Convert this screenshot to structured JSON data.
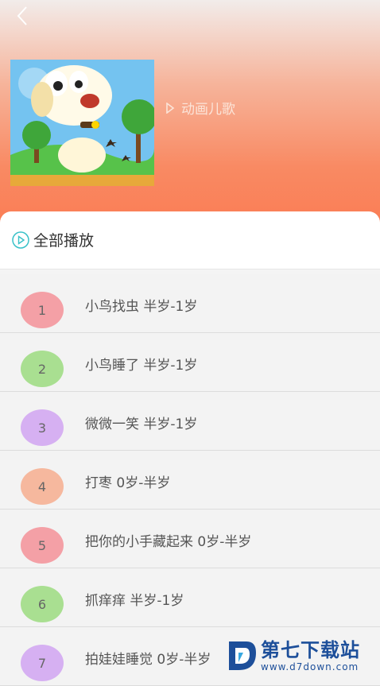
{
  "header": {
    "album_title": "动画儿歌"
  },
  "panel": {
    "play_all_label": "全部播放"
  },
  "songs": [
    {
      "num": "1",
      "title": "小鸟找虫 半岁-1岁",
      "color": "#f4a0a6"
    },
    {
      "num": "2",
      "title": "小鸟睡了 半岁-1岁",
      "color": "#a9df91"
    },
    {
      "num": "3",
      "title": "微微一笑 半岁-1岁",
      "color": "#d6b0f2"
    },
    {
      "num": "4",
      "title": "打枣 0岁-半岁",
      "color": "#f6b89e"
    },
    {
      "num": "5",
      "title": "把你的小手藏起来 0岁-半岁",
      "color": "#f4a0a6"
    },
    {
      "num": "6",
      "title": "抓痒痒 半岁-1岁",
      "color": "#a9df91"
    },
    {
      "num": "7",
      "title": "拍娃娃睡觉 0岁-半岁",
      "color": "#d6b0f2"
    }
  ],
  "watermark": {
    "name": "第七下载站",
    "url": "www.d7down.com"
  },
  "colors": {
    "accent_teal": "#38c1c8",
    "header_orange": "#fa7a52"
  }
}
